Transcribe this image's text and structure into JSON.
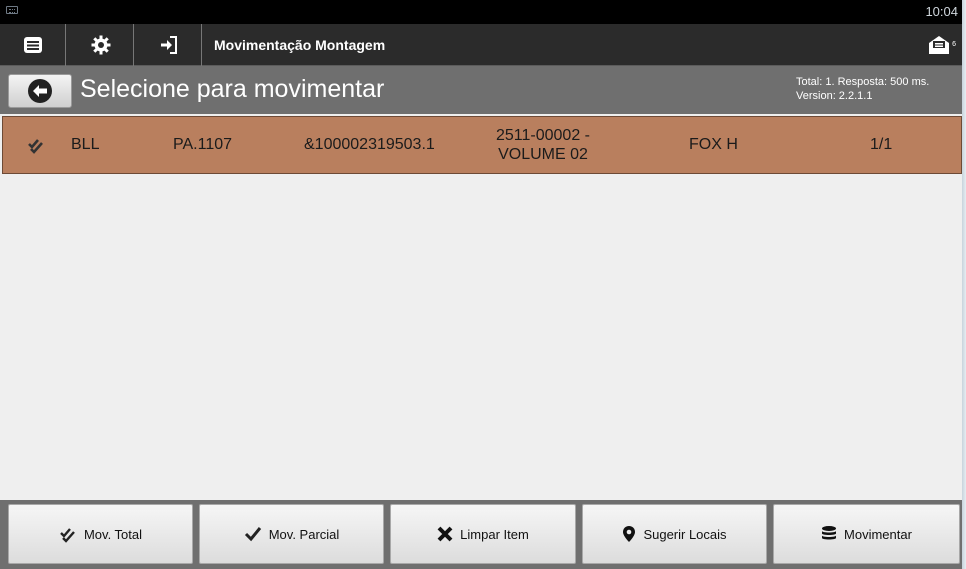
{
  "status": {
    "time": "10:04"
  },
  "toolbar": {
    "title": "Movimentação Montagem",
    "mail_badge": "6",
    "icons": [
      "menu-icon",
      "gear-icon",
      "sign-in-icon",
      "mail-icon"
    ]
  },
  "header": {
    "title": "Selecione para movimentar",
    "info_line1": "Total: 1. Resposta: 500 ms.",
    "info_line2": "Version: 2.2.1.1"
  },
  "list": {
    "rows": [
      {
        "code": "BLL",
        "location": "PA.1107",
        "barcode": "&100002319503.1",
        "document_line1": "2511-00002 -",
        "document_line2": "VOLUME 02",
        "client": "FOX H",
        "count": "1/1",
        "selected": true,
        "color": "#b97f5e"
      }
    ]
  },
  "actions": {
    "mov_total": "Mov. Total",
    "mov_parcial": "Mov. Parcial",
    "limpar_item": "Limpar Item",
    "sugerir_locais": "Sugerir Locais",
    "movimentar": "Movimentar"
  }
}
